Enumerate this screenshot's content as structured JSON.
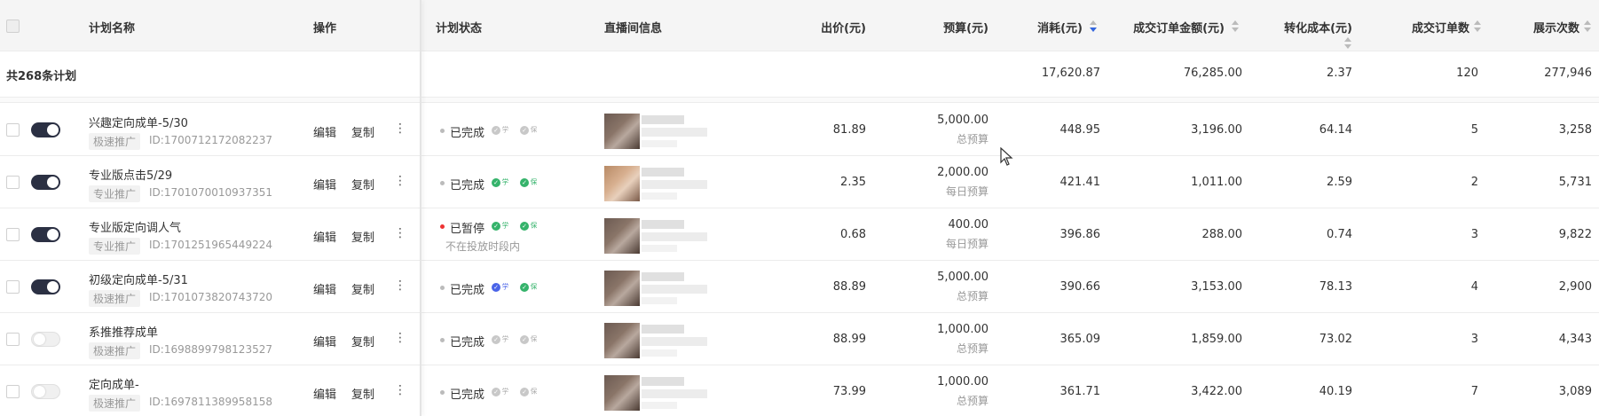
{
  "header": {
    "plan_name": "计划名称",
    "operation": "操作",
    "plan_status": "计划状态",
    "live_info": "直播间信息",
    "bid": "出价(元)",
    "budget": "预算(元)",
    "cost": "消耗(元)",
    "order_amount": "成交订单金额(元)",
    "conversion_cost": "转化成本(元)",
    "order_count": "成交订单数",
    "impressions": "展示次数"
  },
  "summary": {
    "label": "共268条计划",
    "cost": "17,620.87",
    "order_amount": "76,285.00",
    "conversion_cost": "2.37",
    "order_count": "120",
    "impressions": "277,946"
  },
  "rows": [
    {
      "name": "兴趣定向成单-5/30",
      "tag": "极速推广",
      "id": "ID:1700712172082237",
      "edit": "编辑",
      "copy": "复制",
      "status": "已完成",
      "status_sub": "",
      "badge_xue": "学",
      "badge_bao": "保",
      "bid": "81.89",
      "budget": "5,000.00",
      "budget_type": "总预算",
      "cost": "448.95",
      "order_amount": "3,196.00",
      "conversion_cost": "64.14",
      "order_count": "5",
      "impressions": "3,258"
    },
    {
      "name": "专业版点击5/29",
      "tag": "专业推广",
      "id": "ID:1701070010937351",
      "edit": "编辑",
      "copy": "复制",
      "status": "已完成",
      "status_sub": "",
      "badge_xue": "学",
      "badge_bao": "保",
      "bid": "2.35",
      "budget": "2,000.00",
      "budget_type": "每日预算",
      "cost": "421.41",
      "order_amount": "1,011.00",
      "conversion_cost": "2.59",
      "order_count": "2",
      "impressions": "5,731"
    },
    {
      "name": "专业版定向调人气",
      "tag": "专业推广",
      "id": "ID:1701251965449224",
      "edit": "编辑",
      "copy": "复制",
      "status": "已暂停",
      "status_sub": "不在投放时段内",
      "badge_xue": "学",
      "badge_bao": "保",
      "bid": "0.68",
      "budget": "400.00",
      "budget_type": "每日预算",
      "cost": "396.86",
      "order_amount": "288.00",
      "conversion_cost": "0.74",
      "order_count": "3",
      "impressions": "9,822"
    },
    {
      "name": "初级定向成单-5/31",
      "tag": "极速推广",
      "id": "ID:1701073820743720",
      "edit": "编辑",
      "copy": "复制",
      "status": "已完成",
      "status_sub": "",
      "badge_xue": "学",
      "badge_bao": "保",
      "bid": "88.89",
      "budget": "5,000.00",
      "budget_type": "总预算",
      "cost": "390.66",
      "order_amount": "3,153.00",
      "conversion_cost": "78.13",
      "order_count": "4",
      "impressions": "2,900"
    },
    {
      "name": "系推推荐成单",
      "tag": "极速推广",
      "id": "ID:1698899798123527",
      "edit": "编辑",
      "copy": "复制",
      "status": "已完成",
      "status_sub": "",
      "badge_xue": "学",
      "badge_bao": "保",
      "bid": "88.99",
      "budget": "1,000.00",
      "budget_type": "总预算",
      "cost": "365.09",
      "order_amount": "1,859.00",
      "conversion_cost": "73.02",
      "order_count": "3",
      "impressions": "4,343"
    },
    {
      "name": "定向成单-",
      "tag": "极速推广",
      "id": "ID:1697811389958158",
      "edit": "编辑",
      "copy": "复制",
      "status": "已完成",
      "status_sub": "",
      "badge_xue": "学",
      "badge_bao": "保",
      "bid": "73.99",
      "budget": "1,000.00",
      "budget_type": "总预算",
      "cost": "361.71",
      "order_amount": "3,422.00",
      "conversion_cost": "40.19",
      "order_count": "7",
      "impressions": "3,089"
    }
  ]
}
